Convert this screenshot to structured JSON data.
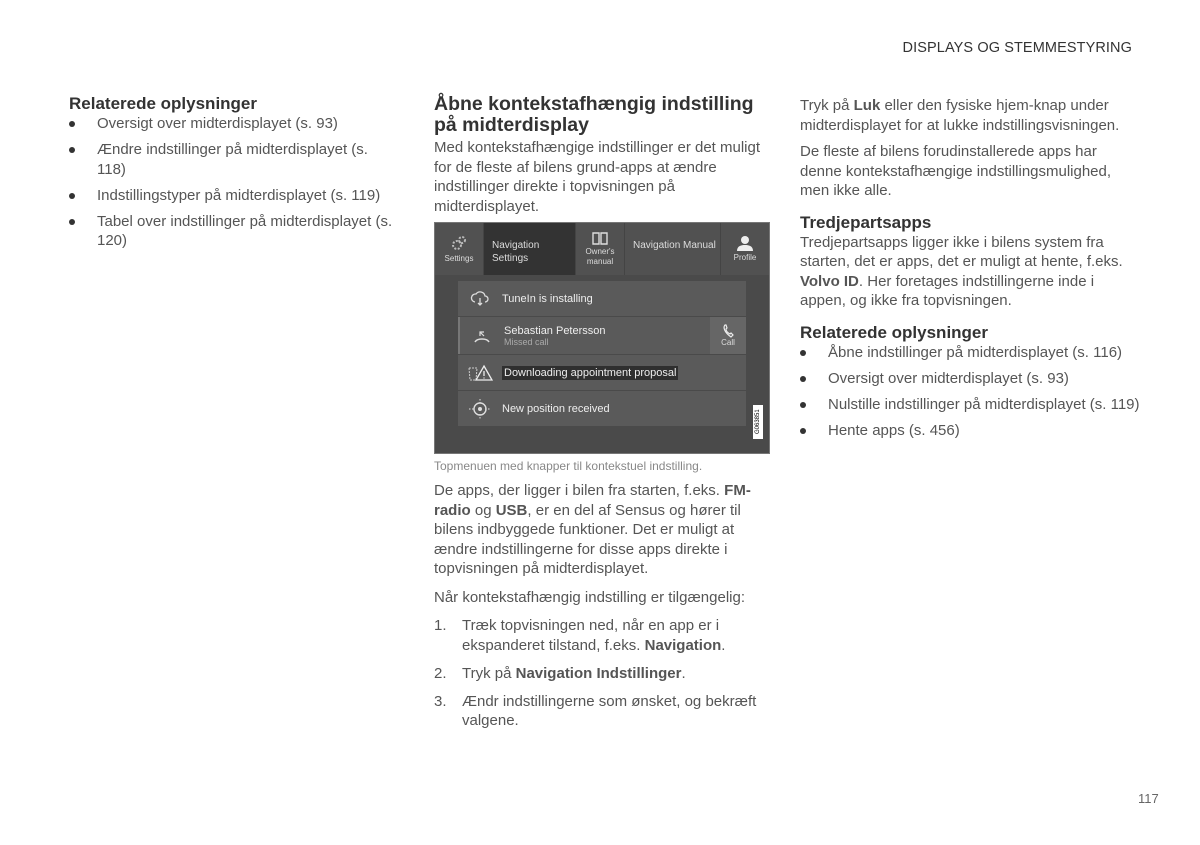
{
  "header": {
    "section_title": "DISPLAYS OG STEMMESTYRING"
  },
  "page_number": "117",
  "col1": {
    "heading": "Relaterede oplysninger",
    "items": [
      "Oversigt over midterdisplayet (s. 93)",
      "Ændre indstillinger på midterdisplayet (s. 118)",
      "Indstillingstyper på midterdisplayet (s. 119)",
      "Tabel over indstillinger på midterdisplayet (s. 120)"
    ]
  },
  "col2": {
    "heading": "Åbne kontekstafhængig indstilling på midterdisplay",
    "intro": "Med kontekstafhængige indstillinger er det muligt for de fleste af bilens grund-apps at ændre indstillinger direkte i topvisningen på midterdisplayet.",
    "figure": {
      "topbar": {
        "settings": "Settings",
        "nav_settings": "Navigation Settings",
        "owners_manual": "Owner's manual",
        "nav_manual": "Navigation Manual",
        "profile": "Profile"
      },
      "notifications": [
        {
          "title": "TuneIn is installing",
          "icon": "cloud-download-icon"
        },
        {
          "title": "Sebastian Petersson",
          "subtitle": "Missed call",
          "icon": "missed-call-icon",
          "action": "Call"
        },
        {
          "title": "Downloading appointment proposal",
          "icon": "warning-icon"
        },
        {
          "title": "New position received",
          "icon": "position-icon"
        }
      ],
      "image_code": "G063851"
    },
    "caption": "Topmenuen med knapper til kontekstuel indstilling.",
    "para1": {
      "a": "De apps, der ligger i bilen fra starten, f.eks. ",
      "b1": "FM-radio",
      "c": " og ",
      "b2": "USB",
      "d": ", er en del af Sensus og hører til bilens indbyggede funktioner. Det er muligt at ændre indstillingerne for disse apps direkte i topvisningen på midterdisplayet."
    },
    "para2": "Når kontekstafhængig indstilling er tilgængelig:",
    "steps": [
      {
        "num": "1.",
        "text": "Træk topvisningen ned, når en app er i ekspanderet tilstand, f.eks. ",
        "bold": "Navigation",
        "end": "."
      },
      {
        "num": "2.",
        "text": "Tryk på ",
        "bold": "Navigation Indstillinger",
        "end": "."
      },
      {
        "num": "3.",
        "text": "Ændr indstillingerne som ønsket, og bekræft valgene.",
        "bold": "",
        "end": ""
      }
    ]
  },
  "col3": {
    "para1": {
      "a": "Tryk på ",
      "b": "Luk",
      "c": " eller den fysiske hjem-knap under midterdisplayet for at lukke indstillingsvisningen."
    },
    "para2": "De fleste af bilens forudinstallerede apps har denne kontekstafhængige indstillingsmulighed, men ikke alle.",
    "third_party_heading": "Tredjepartsapps",
    "third_party": {
      "a": "Tredjepartsapps ligger ikke i bilens system fra starten, det er apps, det er muligt at hente, f.eks. ",
      "b": "Volvo ID",
      "c": ". Her foretages indstillingerne inde i appen, og ikke fra topvisningen."
    },
    "heading": "Relaterede oplysninger",
    "items": [
      "Åbne indstillinger på midterdisplayet (s. 116)",
      "Oversigt over midterdisplayet (s. 93)",
      "Nulstille indstillinger på midterdisplayet (s. 119)",
      "Hente apps (s. 456)"
    ]
  }
}
